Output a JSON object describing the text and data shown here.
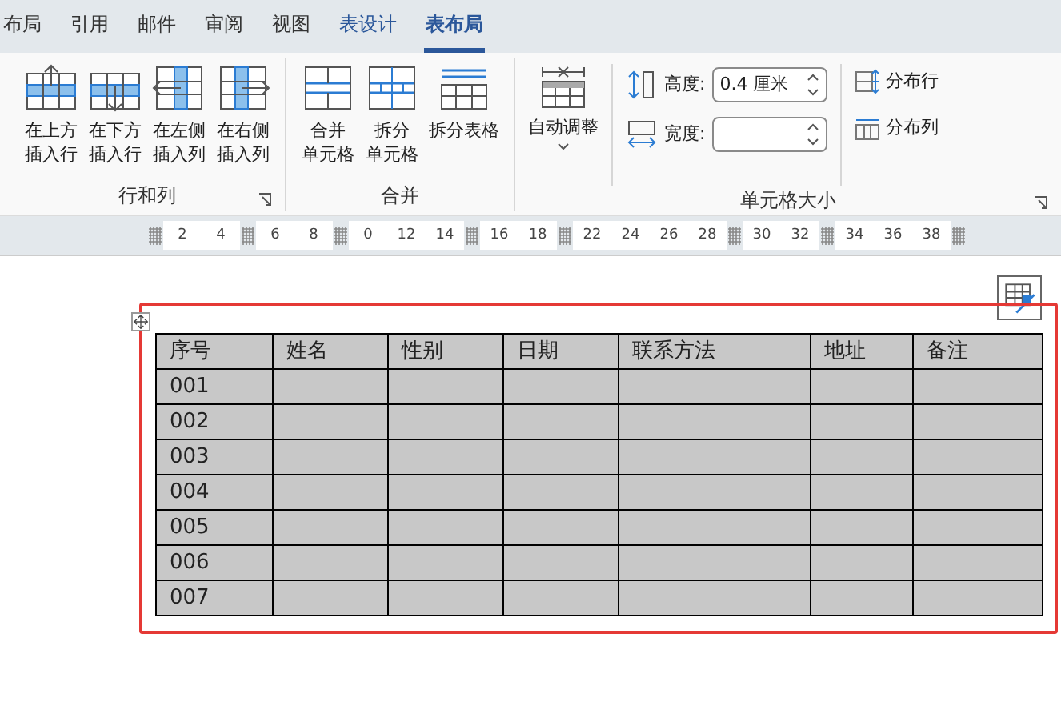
{
  "tabs": [
    {
      "label": "布局",
      "selected": false,
      "kind": "plain"
    },
    {
      "label": "引用",
      "selected": false,
      "kind": "plain"
    },
    {
      "label": "邮件",
      "selected": false,
      "kind": "plain"
    },
    {
      "label": "审阅",
      "selected": false,
      "kind": "plain"
    },
    {
      "label": "视图",
      "selected": false,
      "kind": "plain"
    },
    {
      "label": "表设计",
      "selected": false,
      "kind": "context"
    },
    {
      "label": "表布局",
      "selected": true,
      "kind": "context"
    }
  ],
  "ribbon": {
    "groups": [
      {
        "label": "行和列",
        "launcher": true,
        "buttons": [
          {
            "lines": [
              "在上方",
              "插入行"
            ],
            "kind": "row-above"
          },
          {
            "lines": [
              "在下方",
              "插入行"
            ],
            "kind": "row-below"
          },
          {
            "lines": [
              "在左侧",
              "插入列"
            ],
            "kind": "col-left"
          },
          {
            "lines": [
              "在右侧",
              "插入列"
            ],
            "kind": "col-right"
          }
        ]
      },
      {
        "label": "合并",
        "buttons": [
          {
            "lines": [
              "合并",
              "单元格"
            ],
            "kind": "merge"
          },
          {
            "lines": [
              "拆分",
              "单元格"
            ],
            "kind": "split"
          },
          {
            "lines": [
              "拆分表格"
            ],
            "kind": "split-table"
          }
        ]
      }
    ],
    "cell_size": {
      "label": "单元格大小",
      "launcher": true,
      "autofit": {
        "label": "自动调整"
      },
      "height": {
        "label": "高度:",
        "value": "0.4 厘米"
      },
      "width": {
        "label": "宽度:"
      },
      "distribute_rows": "分布行",
      "distribute_columns": "分布列"
    }
  },
  "ruler": [
    {
      "kind": "marker"
    },
    {
      "kind": "number",
      "text": "2"
    },
    {
      "kind": "number",
      "text": "4"
    },
    {
      "kind": "marker"
    },
    {
      "kind": "number",
      "text": "6"
    },
    {
      "kind": "number",
      "text": "8"
    },
    {
      "kind": "marker"
    },
    {
      "kind": "number",
      "text": "0"
    },
    {
      "kind": "number",
      "text": "12"
    },
    {
      "kind": "number",
      "text": "14"
    },
    {
      "kind": "marker"
    },
    {
      "kind": "number",
      "text": "16"
    },
    {
      "kind": "number",
      "text": "18"
    },
    {
      "kind": "marker"
    },
    {
      "kind": "number",
      "text": "22"
    },
    {
      "kind": "number",
      "text": "24"
    },
    {
      "kind": "number",
      "text": "26"
    },
    {
      "kind": "number",
      "text": "28"
    },
    {
      "kind": "marker"
    },
    {
      "kind": "number",
      "text": "30"
    },
    {
      "kind": "number",
      "text": "32"
    },
    {
      "kind": "marker"
    },
    {
      "kind": "number",
      "text": "34"
    },
    {
      "kind": "number",
      "text": "36"
    },
    {
      "kind": "number",
      "text": "38"
    },
    {
      "kind": "marker"
    }
  ],
  "table": {
    "selected": true,
    "columns": [
      "序号",
      "姓名",
      "性别",
      "日期",
      "联系方法",
      "地址",
      "备注"
    ],
    "rows": [
      [
        "001",
        "",
        "",
        "",
        "",
        "",
        ""
      ],
      [
        "002",
        "",
        "",
        "",
        "",
        "",
        ""
      ],
      [
        "003",
        "",
        "",
        "",
        "",
        "",
        ""
      ],
      [
        "004",
        "",
        "",
        "",
        "",
        "",
        ""
      ],
      [
        "005",
        "",
        "",
        "",
        "",
        "",
        ""
      ],
      [
        "006",
        "",
        "",
        "",
        "",
        "",
        ""
      ],
      [
        "007",
        "",
        "",
        "",
        "",
        "",
        ""
      ]
    ]
  }
}
